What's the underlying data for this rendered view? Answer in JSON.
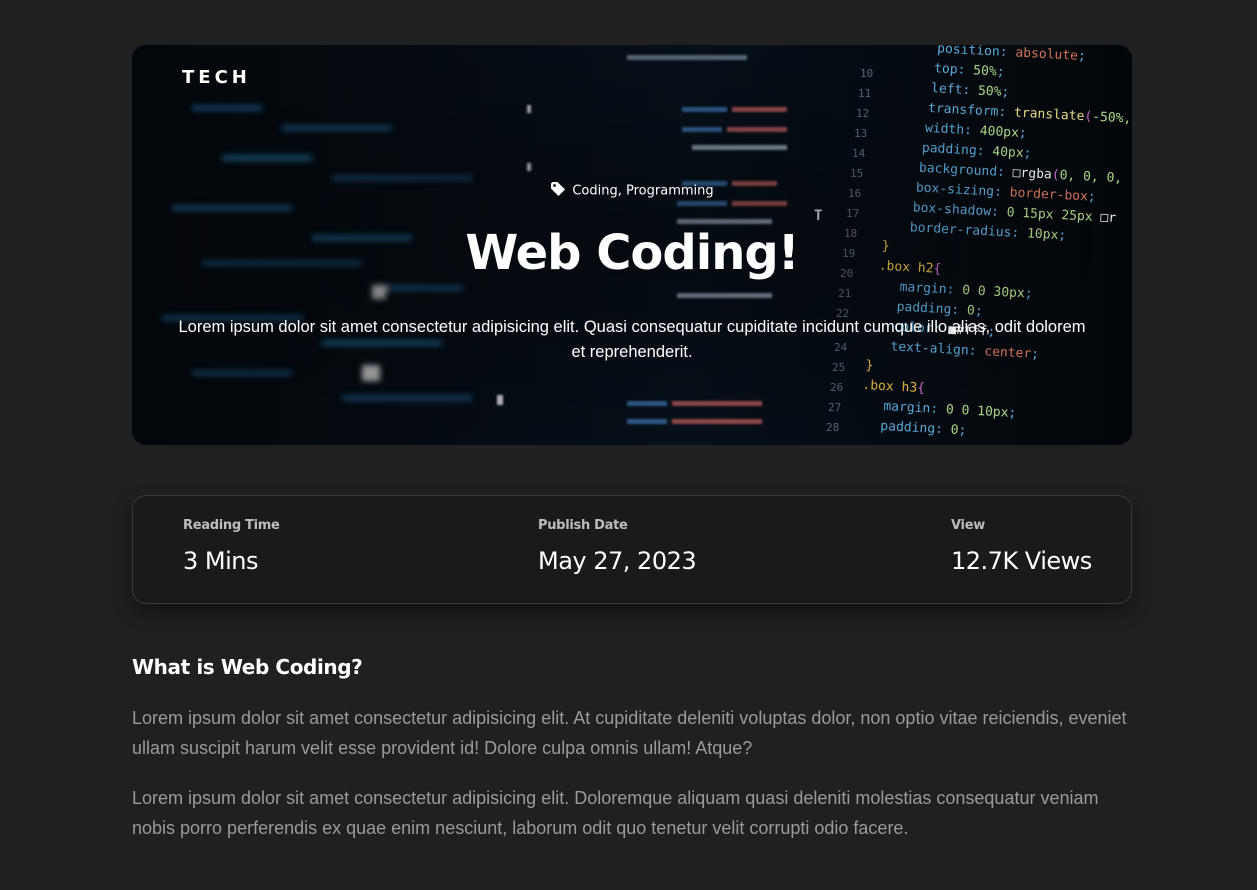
{
  "hero": {
    "brand": "TECH",
    "tags": "Coding, Programming",
    "title": "Web Coding!",
    "description": "Lorem ipsum dolor sit amet consectetur adipisicing elit. Quasi consequatur cupiditate incidunt cumque illo alias, odit dolorem et reprehenderit.",
    "tag_icon": "tag-icon"
  },
  "meta": {
    "reading_time_label": "Reading Time",
    "reading_time_value": "3 Mins",
    "publish_date_label": "Publish Date",
    "publish_date_value": "May 27, 2023",
    "view_label": "View",
    "view_value": "12.7K Views"
  },
  "article": {
    "heading": "What is Web Coding?",
    "paragraphs": [
      "Lorem ipsum dolor sit amet consectetur adipisicing elit. At cupiditate deleniti voluptas dolor, non optio vitae reiciendis, eveniet ullam suscipit harum velit esse provident id! Dolore culpa omnis ullam! Atque?",
      "Lorem ipsum dolor sit amet consectetur adipisicing elit. Doloremque aliquam quasi deleniti molestias consequatur veniam nobis porro perferendis ex quae enim nesciunt, laborum odit quo tenetur velit corrupti odio facere."
    ]
  },
  "colors": {
    "page_background": "#202020",
    "card_background": "#1a1a1a",
    "text_primary": "#ffffff",
    "text_muted": "#9a9a9a"
  }
}
